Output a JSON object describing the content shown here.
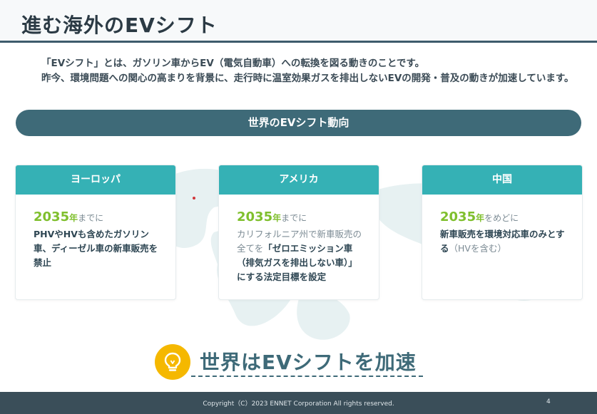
{
  "title": "進む海外のEVシフト",
  "intro": {
    "line1": "「EVシフト」とは、ガソリン車からEV（電気自動車）への転換を図る動きのことです。",
    "line2": "昨今、環境問題への関心の高まりを背景に、走行時に温室効果ガスを排出しないEVの開発・普及の動きが加速しています。"
  },
  "section_heading": "世界のEVシフト動向",
  "cards": [
    {
      "region": "ヨーロッパ",
      "year": "2035",
      "nen": "年",
      "suffix": "までに",
      "body": "PHVやHVも含めたガソリン車、ディーゼル車の新車販売を禁止"
    },
    {
      "region": "アメリカ",
      "year": "2035",
      "nen": "年",
      "suffix": "までに",
      "body_soft": "カリフォルニア州で新車販売の全てを",
      "body_strong": "「ゼロエミッション車（排気ガスを排出しない車）」にする法定目標を設定"
    },
    {
      "region": "中国",
      "year": "2035",
      "nen": "年",
      "suffix": "をめどに",
      "body_strong": "新車販売を環境対応車のみとする",
      "body_soft": "（HVを含む）"
    }
  ],
  "slogan": "世界はEVシフトを加速",
  "footer": {
    "copyright": "Copyright（C）2023 ENNET Corporation All rights reserved.",
    "page": "4"
  },
  "colors": {
    "accent_teal": "#35b1b5",
    "bar_blue": "#3e6a78",
    "year_green": "#7fbf2d",
    "bulb_yellow": "#f5b800",
    "footer": "#3a4e59"
  },
  "icons": [
    "world-map-background",
    "lightbulb-icon"
  ]
}
